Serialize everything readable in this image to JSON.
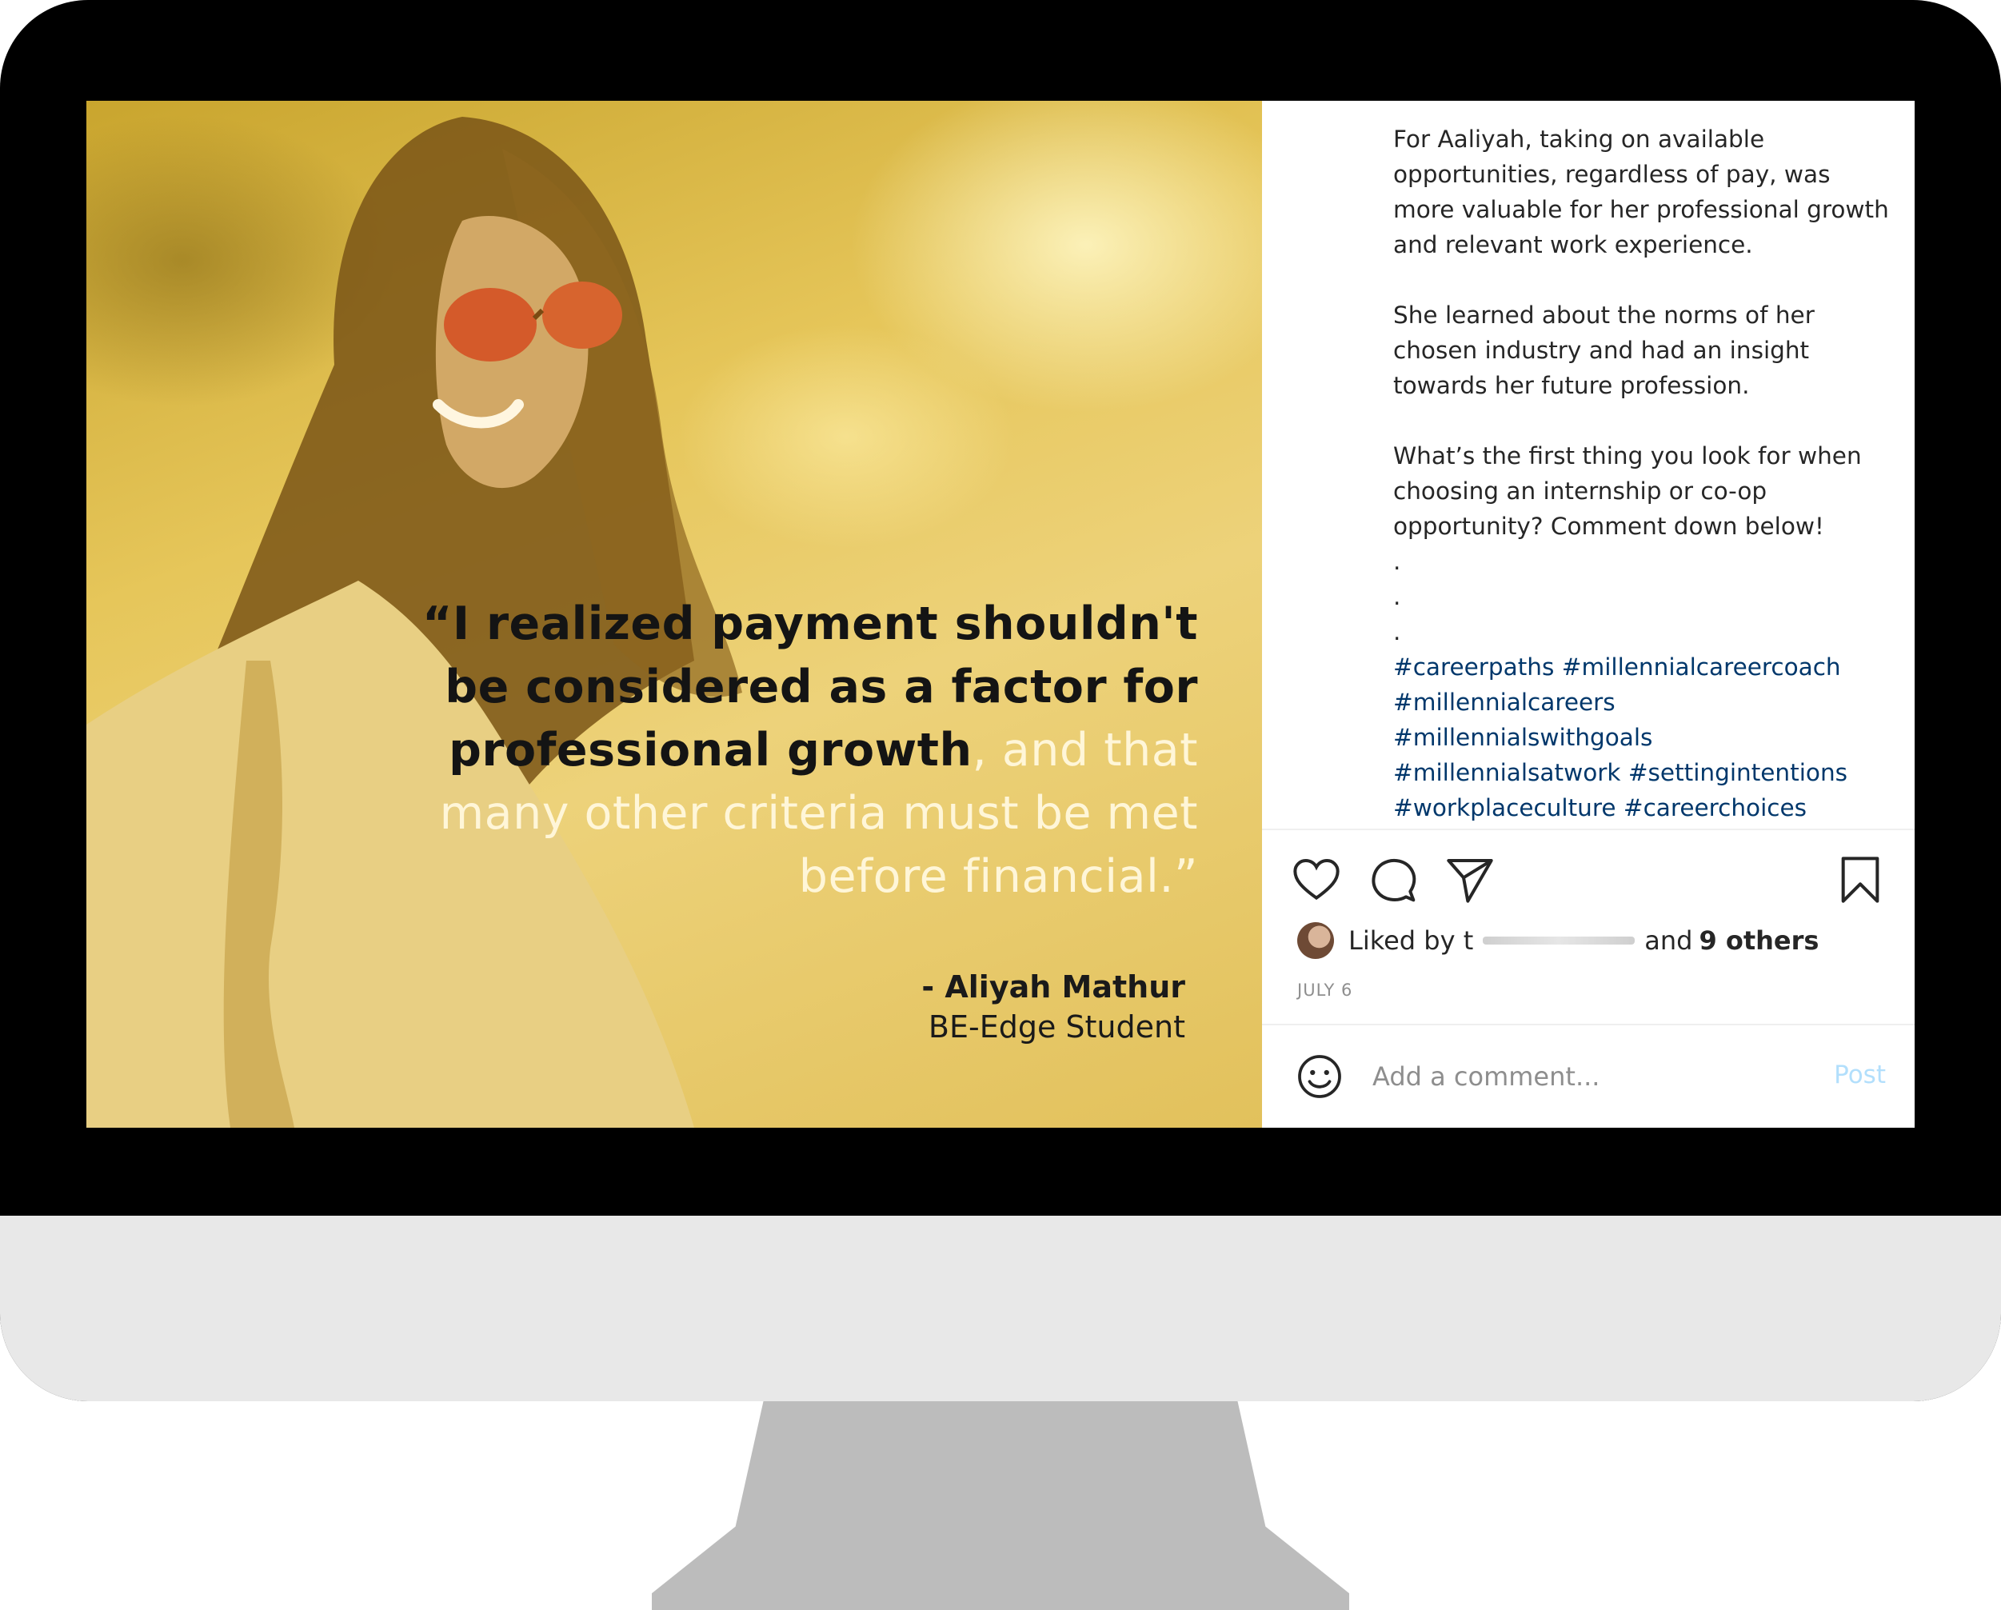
{
  "photo": {
    "quote_bold": "“I realized payment shouldn't be considered as a factor for professional growth",
    "quote_light": ", and that many other criteria must be met before financial.”",
    "author_name": "- Aliyah Mathur",
    "author_title": "BE-Edge Student"
  },
  "caption": {
    "paragraphs": [
      "For Aaliyah, taking on available opportunities, regardless of pay, was more valuable for her professional growth and relevant work experience.",
      "She learned about the norms of her chosen industry and had an insight towards her future profession.",
      "What’s the first thing you look for when choosing an internship or co-op opportunity? Comment down below!"
    ],
    "dots": [
      ".",
      ".",
      "."
    ],
    "hashtags": [
      "#careerpaths #millennialcareercoach",
      "#millennialcareers",
      "#millennialswithgoals",
      "#millennialsatwork #settingintentions",
      "#workplaceculture #careerchoices"
    ]
  },
  "icons": {
    "like": "heart-icon",
    "comment": "comment-icon",
    "share": "paper-plane-icon",
    "save": "bookmark-icon",
    "emoji": "smiley-icon"
  },
  "likes": {
    "prefix": "Liked by t",
    "middle": "and",
    "others": "9 others"
  },
  "date": "JULY 6",
  "comment_box": {
    "placeholder": "Add a comment...",
    "post_label": "Post"
  },
  "colors": {
    "overlay_yellow": "#e6c65a",
    "hashtag": "#00376b",
    "post_disabled": "#b2dffc",
    "monitor_bezel": "#000000",
    "monitor_chin": "#e8e8e8",
    "monitor_stand": "#bcbcbc"
  }
}
